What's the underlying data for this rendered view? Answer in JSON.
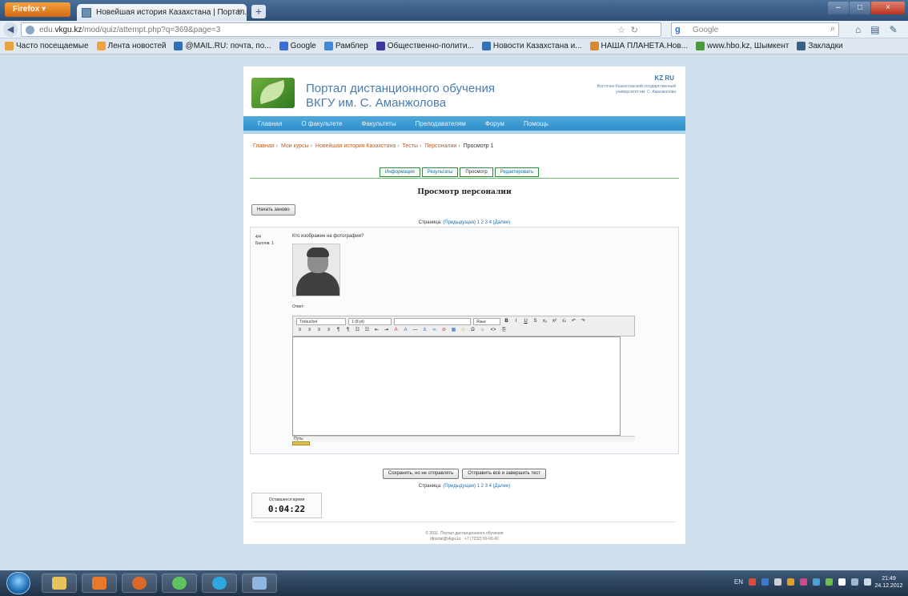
{
  "browser": {
    "menu_label": "Firefox",
    "tab_title": "Новейшая история Казахстана | Портал...",
    "tab_close": "×",
    "new_tab": "+",
    "win_controls": [
      "–",
      "□",
      "×"
    ],
    "url": {
      "prefix": "edu.",
      "host": "vkgu.kz",
      "rest": "/mod/quiz/attempt.php?q=369&page=3"
    },
    "search_placeholder": "Google",
    "search_engine_glyph": "g",
    "bookmarks": [
      {
        "label": "Часто посещаемые",
        "color": "#e8a33c"
      },
      {
        "label": "Лента новостей",
        "color": "#f1a33b"
      },
      {
        "label": "@MAIL.RU: почта, по...",
        "color": "#2f6fb7"
      },
      {
        "label": "Google",
        "color": "#3b6dd8"
      },
      {
        "label": "Рамблер",
        "color": "#3f8ad6"
      },
      {
        "label": "Общественно-полити...",
        "color": "#3a3a9c"
      },
      {
        "label": "Новости Казахстана и...",
        "color": "#3472b5"
      },
      {
        "label": "НАША ПЛАНЕТА.Нов...",
        "color": "#d98a2f"
      },
      {
        "label": "www.hbo.kz, Шымкент",
        "color": "#4a9b3c"
      },
      {
        "label": "Закладки",
        "color": "#3c5f84"
      }
    ]
  },
  "site": {
    "title_line1": "Портал дистанционного обучения",
    "title_line2": "ВКГУ им. С. Аманжолова",
    "flags": "KZ RU",
    "header_note_line1": "Восточно-Казахстанский государственный",
    "header_note_line2": "университет им. С. Аманжолова",
    "menu": [
      "Главная",
      "О факультете",
      "Факультеты",
      "Преподавателям",
      "Форум",
      "Помощь"
    ]
  },
  "breadcrumbs": {
    "items": [
      "Главная",
      "Мои курсы",
      "Новейшая история Казахстана",
      "Тесты",
      "Персоналии"
    ],
    "current": "Просмотр 1",
    "separator": "›"
  },
  "quiz_tabs": [
    "Информация",
    "Результаты",
    "Просмотр",
    "Редактировать"
  ],
  "preview": {
    "title": "Просмотр персоналии",
    "start_again": "Начать заново",
    "pages_label": "Страница:",
    "pages_prev": "(Предыдущая)",
    "pages_list": "1 2 3 4",
    "pages_next": "(Далее)",
    "question_number": "4/4",
    "question_score": "Баллов: 1",
    "question_text": "Кто изображен на фотографии?",
    "answer_label": "Ответ:"
  },
  "editor": {
    "font_select": "Trebuchet",
    "size_select": "1 (8 pt)",
    "blank_select": "",
    "lang_select": "Язык",
    "toolbar_row1": [
      "B",
      "I",
      "U",
      "S",
      "x₂",
      "x²",
      "⎌",
      "↶",
      "↷"
    ],
    "toolbar_row2": [
      "≡",
      "≡",
      "≡",
      "≡",
      "¶",
      "¶",
      "☷",
      "☷",
      "⇤",
      "⇥",
      "A",
      "A",
      "—",
      "⚓",
      "∞",
      "⊘",
      "▦",
      "☺",
      "Ω",
      "⌂",
      "<>",
      "⎘"
    ],
    "path_label": "Путь:"
  },
  "submit": {
    "save_label": "Сохранить, но не отправлять",
    "send_label": "Отправить всё и завершить тест"
  },
  "timer": {
    "label": "Оставшееся время",
    "value": "0:04:22"
  },
  "footer": {
    "line1": "© 2011. Портал дистанционного обучения",
    "line2": "dlportal@vkgu.kz · +7 (7232) 00-00-00"
  },
  "taskbar": {
    "apps": [
      {
        "name": "explorer",
        "color": "#e8c35c"
      },
      {
        "name": "media-player",
        "color": "#e77a2a"
      },
      {
        "name": "firefox",
        "color": "#d9692b"
      },
      {
        "name": "chat-app",
        "color": "#5cc35e"
      },
      {
        "name": "skype",
        "color": "#2ea6e0"
      },
      {
        "name": "document-viewer",
        "color": "#8fb6de"
      }
    ],
    "tray_lang": "EN",
    "clock_time": "21:49",
    "clock_date": "24.12.2012"
  }
}
